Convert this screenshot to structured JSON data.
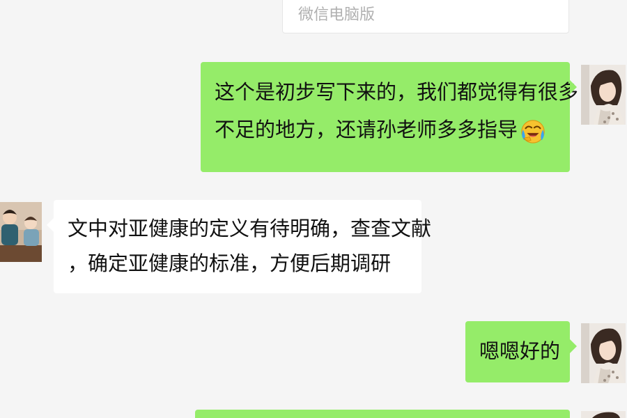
{
  "top_card": {
    "label": "微信电脑版"
  },
  "messages": [
    {
      "side": "right",
      "lines": [
        "这个是初步写下来的，我们都觉得有很多",
        "不足的地方，还请孙老师多多指导"
      ],
      "emoji": "crying-laughing-face"
    },
    {
      "side": "left",
      "lines": [
        "文中对亚健康的定义有待明确，查查文献",
        "，确定亚健康的标准，方便后期调研"
      ]
    },
    {
      "side": "right",
      "lines": [
        "嗯嗯好的"
      ]
    },
    {
      "side": "right",
      "lines": []
    }
  ],
  "colors": {
    "background": "#f5f5f5",
    "outgoing_bubble": "#95ec69",
    "incoming_bubble": "#ffffff"
  }
}
